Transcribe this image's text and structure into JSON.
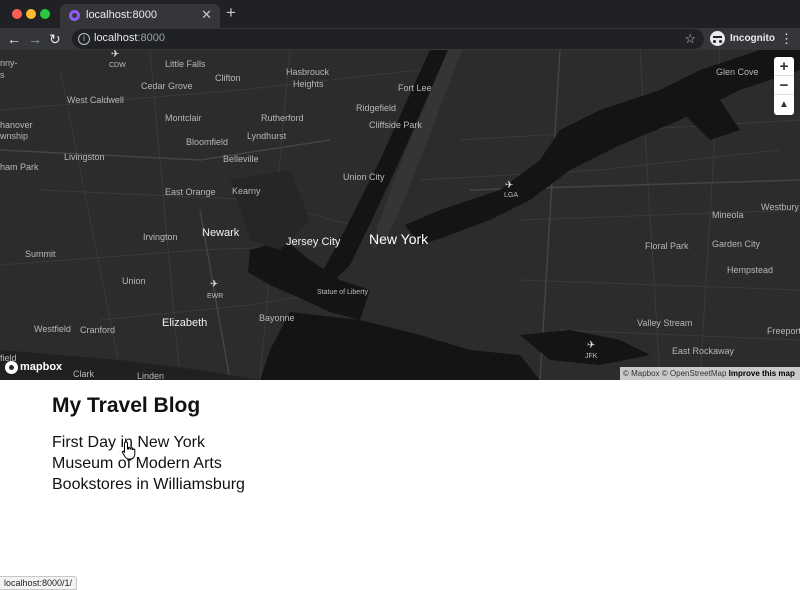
{
  "browser": {
    "tab_title": "localhost:8000",
    "tab_close": "✕",
    "new_tab": "+",
    "url_host": "localhost",
    "url_port": ":8000",
    "profile_label": "Incognito",
    "back_icon": "←",
    "forward_icon": "→",
    "reload_icon": "↻",
    "star_icon": "☆",
    "menu_icon": "⋮",
    "info_icon": "i"
  },
  "map": {
    "labels": {
      "cdw": "CDW",
      "little_falls": "Little Falls",
      "glen_cove": "Glen Cove",
      "hasbrouck": "Hasbrouck",
      "heights": "Heights",
      "cedar_grove": "Cedar Grove",
      "clifton": "Clifton",
      "fort_lee": "Fort Lee",
      "west_caldwell": "West Caldwell",
      "ridgefield": "Ridgefield",
      "montclair": "Montclair",
      "rutherford": "Rutherford",
      "cliffside_park": "Cliffside Park",
      "lyndhurst": "Lyndhurst",
      "bloomfield": "Bloomfield",
      "livingston": "Livingston",
      "belleville": "Belleville",
      "union_city": "Union City",
      "east_orange": "East Orange",
      "kearny": "Kearny",
      "lga": "LGA",
      "mineola": "Mineola",
      "westbury": "Westbury",
      "irvington": "Irvington",
      "newark": "Newark",
      "jersey_city": "Jersey City",
      "new_york": "New York",
      "floral_park": "Floral Park",
      "garden_city": "Garden City",
      "summit": "Summit",
      "hempstead": "Hempstead",
      "union": "Union",
      "statue_of_liberty": "Statue of Liberty",
      "ewr": "EWR",
      "bayonne": "Bayonne",
      "valley_stream": "Valley Stream",
      "westfield": "Westfield",
      "cranford": "Cranford",
      "elizabeth": "Elizabeth",
      "freeport": "Freeport",
      "jfk": "JFK",
      "east_rockaway": "East Rockaway",
      "clark": "Clark",
      "linden": "Linden",
      "edge_nny": "nny-",
      "edge_s": "s",
      "edge_hanover": "hanover",
      "edge_wnship": "wnship",
      "edge_ham_park": "ham Park",
      "edge_field": "field"
    },
    "zoom_in": "+",
    "zoom_out": "−",
    "compass": "▲",
    "logo_text": "mapbox",
    "attribution": "© Mapbox © OpenStreetMap",
    "improve_link": "Improve this map"
  },
  "page": {
    "title": "My Travel Blog",
    "posts": [
      "First Day in New York",
      "Museum of Modern Arts",
      "Bookstores in Williamsburg"
    ]
  },
  "status_bar": {
    "url": "localhost:8000/1/"
  }
}
